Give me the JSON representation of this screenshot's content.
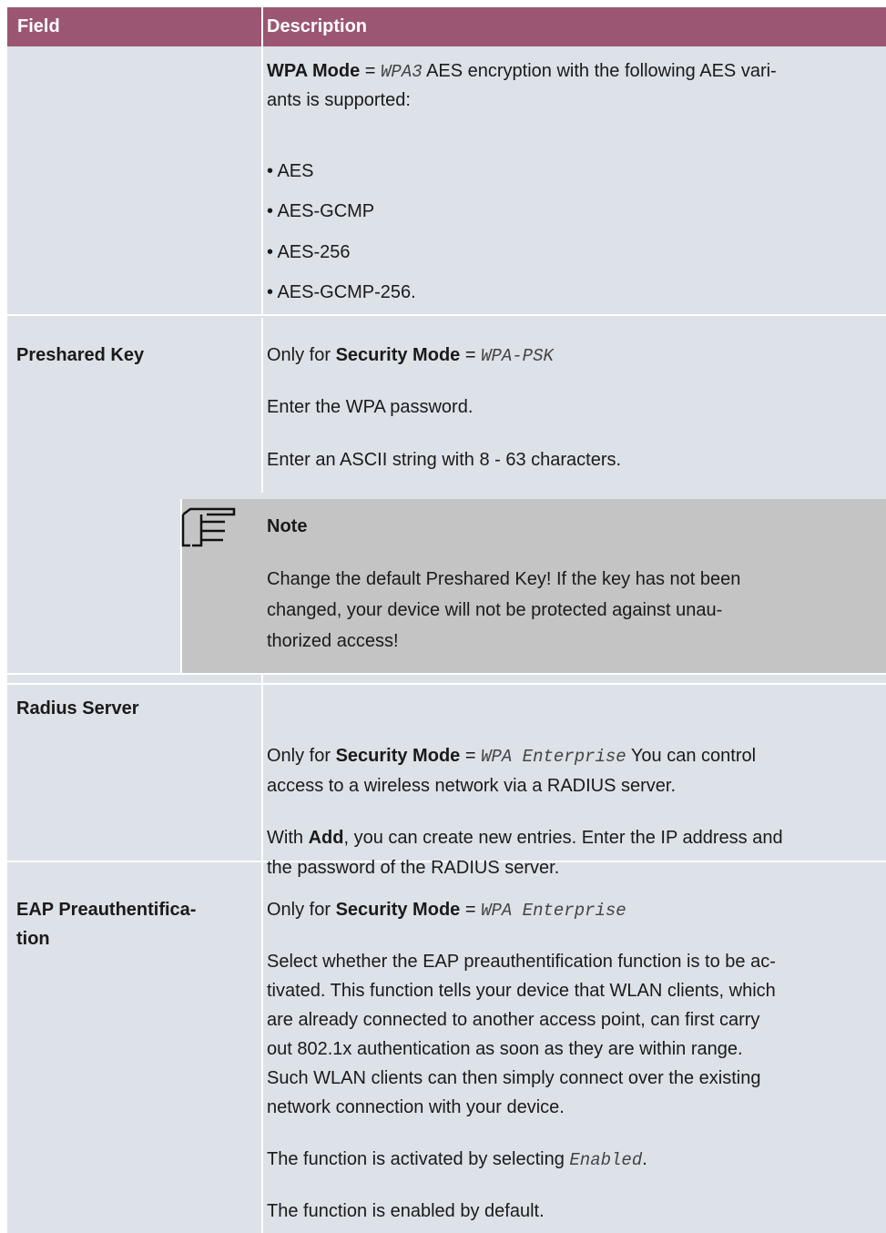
{
  "header": {
    "field": "Field",
    "description": "Description"
  },
  "wpa_row": {
    "label": "WPA Mode",
    "eq": " = ",
    "value": "WPA3",
    "text_a": " AES encryption with the following AES vari-",
    "text_b": "ants is supported:",
    "variants": [
      "AES",
      "AES-GCMP",
      "AES-256",
      "AES-GCMP-256."
    ]
  },
  "preshared_row": {
    "field": "Preshared Key",
    "only_for": "Only for ",
    "security_mode": "Security Mode",
    "eq": " = ",
    "mode_value": "WPA-PSK",
    "line2": "Enter the WPA password.",
    "line3": "Enter an ASCII string with 8 - 63 characters."
  },
  "note": {
    "title": "Note",
    "line1": "Change the default Preshared Key! If the key has not been",
    "line2": "changed, your device will not be protected against unau-",
    "line3": "thorized access!"
  },
  "radius_row": {
    "field": "Radius Server",
    "only_for": "Only for ",
    "security_mode": "Security Mode",
    "eq": " = ",
    "mode_value": "WPA Enterprise",
    "text_a": " You can control",
    "text_b": "access to a wireless network via a RADIUS server.",
    "with": "With ",
    "add": "Add",
    "text_c": ", you can create new entries. Enter the IP address and",
    "text_d": "the password of the RADIUS server."
  },
  "eap_row": {
    "field_line1": "EAP Preauthentifica-",
    "field_line2": "tion",
    "only_for": "Only for ",
    "security_mode": "Security Mode",
    "eq": " = ",
    "mode_value": "WPA Enterprise",
    "para": [
      "Select whether the EAP preauthentification function is to be ac-",
      "tivated. This function tells your device that WLAN clients, which",
      "are already connected to another access point, can first carry",
      "out 802.1x authentication as soon as they are within range.",
      "Such WLAN clients can then simply connect over the existing",
      "network connection with your device."
    ],
    "activated_text": "The function is activated by selecting ",
    "enabled_value": "Enabled",
    "period": ".",
    "default_text": "The function is enabled by default."
  }
}
